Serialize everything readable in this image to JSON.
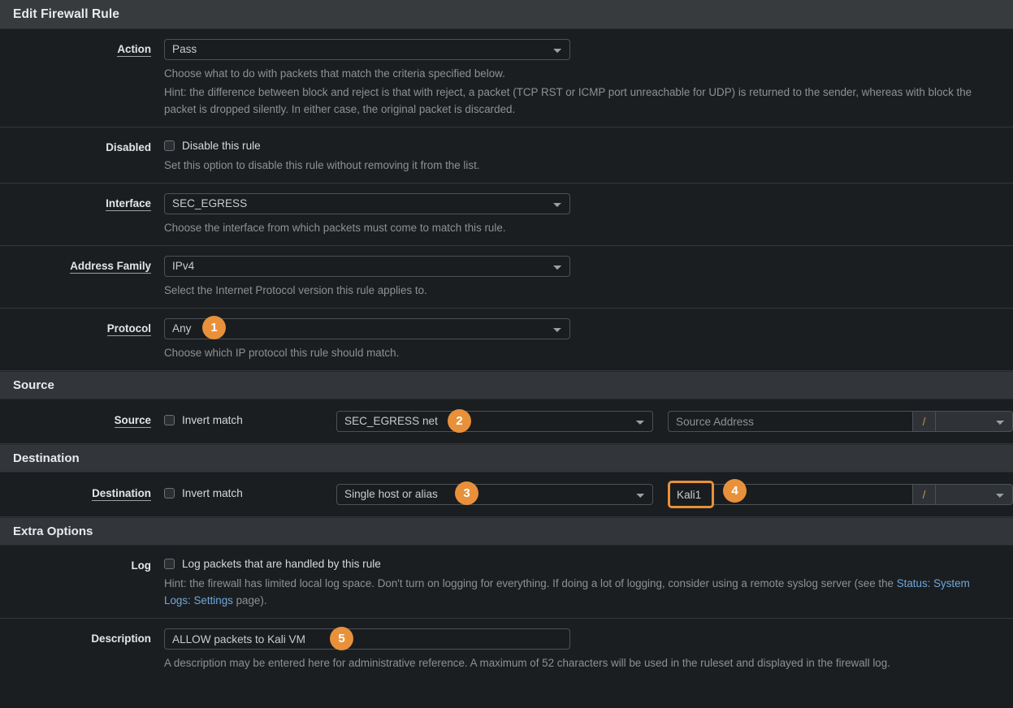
{
  "window": {
    "title": "Edit Firewall Rule"
  },
  "fields": {
    "action": {
      "label": "Action",
      "value": "Pass",
      "help_line1": "Choose what to do with packets that match the criteria specified below.",
      "help_line2": "Hint: the difference between block and reject is that with reject, a packet (TCP RST or ICMP port unreachable for UDP) is returned to the sender, whereas with block the packet is dropped silently. In either case, the original packet is discarded."
    },
    "disabled": {
      "label": "Disabled",
      "checkbox_label": "Disable this rule",
      "checked": false,
      "help": "Set this option to disable this rule without removing it from the list."
    },
    "interface": {
      "label": "Interface",
      "value": "SEC_EGRESS",
      "help": "Choose the interface from which packets must come to match this rule."
    },
    "address_family": {
      "label": "Address Family",
      "value": "IPv4",
      "help": "Select the Internet Protocol version this rule applies to."
    },
    "protocol": {
      "label": "Protocol",
      "value": "Any",
      "help": "Choose which IP protocol this rule should match."
    }
  },
  "source_section": {
    "heading": "Source",
    "row_label": "Source",
    "invert_label": "Invert match",
    "invert_checked": false,
    "type_value": "SEC_EGRESS net",
    "address_placeholder": "Source Address",
    "address_value": "",
    "slash": "/",
    "mask_value": ""
  },
  "destination_section": {
    "heading": "Destination",
    "row_label": "Destination",
    "invert_label": "Invert match",
    "invert_checked": false,
    "type_value": "Single host or alias",
    "address_placeholder": "",
    "address_value": "Kali1",
    "slash": "/",
    "mask_value": ""
  },
  "extra_options": {
    "heading": "Extra Options",
    "log": {
      "label": "Log",
      "checkbox_label": "Log packets that are handled by this rule",
      "checked": false,
      "help_before": "Hint: the firewall has limited local log space. Don't turn on logging for everything. If doing a lot of logging, consider using a remote syslog server (see the ",
      "help_link": "Status: System Logs: Settings",
      "help_after": " page)."
    },
    "description": {
      "label": "Description",
      "value": "ALLOW packets to Kali VM",
      "help": "A description may be entered here for administrative reference. A maximum of 52 characters will be used in the ruleset and displayed in the firewall log."
    }
  },
  "step_badges": [
    {
      "number": "1",
      "target": "protocol-select"
    },
    {
      "number": "2",
      "target": "source-type-select"
    },
    {
      "number": "3",
      "target": "destination-type-select"
    },
    {
      "number": "4",
      "target": "destination-address-token"
    },
    {
      "number": "5",
      "target": "description-input"
    }
  ],
  "colors": {
    "accent_badge": "#e8913a",
    "panel_header_bg": "#373b3e",
    "section_header_bg": "#32363a",
    "page_bg": "#1b1e20",
    "link": "#6ea8dc",
    "slash_addon_text": "#c8933f"
  }
}
